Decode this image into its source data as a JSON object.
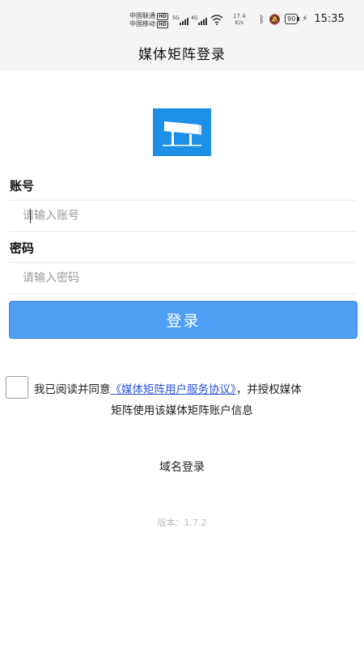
{
  "status_bar": {
    "carrier1": "中国联通",
    "carrier2": "中国移动",
    "hd_badge": "HD",
    "signal1_label": "5G",
    "signal2_label": "4G",
    "speed_value": "17.4",
    "speed_unit": "K/s",
    "battery": "90",
    "time": "15:35"
  },
  "header": {
    "title": "媒体矩阵登录"
  },
  "form": {
    "account_label": "账号",
    "account_placeholder": "请输入账号",
    "password_label": "密码",
    "password_placeholder": "请输入密码",
    "login_button": "登录"
  },
  "agreement": {
    "prefix": "我已阅读并同意",
    "link": "《媒体矩阵用户服务协议》",
    "suffix": "，并授权媒体",
    "line2": "矩阵使用该媒体矩阵账户信息"
  },
  "domain_login": "域名登录",
  "version": "版本：1.7.2",
  "colors": {
    "accent": "#4e9ef5",
    "logo_bg": "#1e8fe6",
    "link": "#2a55d8"
  }
}
